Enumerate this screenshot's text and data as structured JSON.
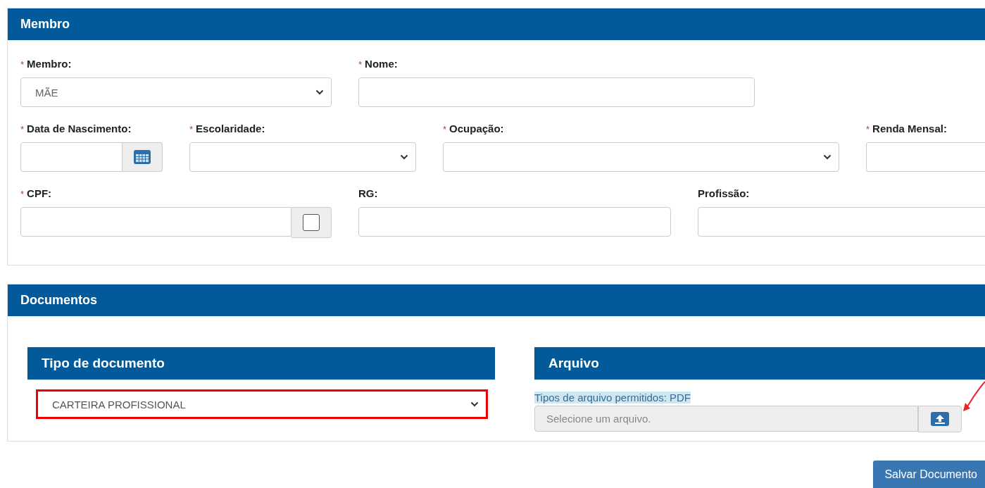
{
  "member_panel": {
    "title": "Membro",
    "rows": [
      {
        "fields": [
          {
            "required_mark": "*",
            "label": "Membro:",
            "kind": "select",
            "value": "MÃE"
          },
          {
            "required_mark": "*",
            "label": "Nome:",
            "kind": "text"
          }
        ]
      },
      {
        "fields": [
          {
            "required_mark": "*",
            "label": "Data de Nascimento:",
            "kind": "date"
          },
          {
            "required_mark": "*",
            "label": "Escolaridade:",
            "kind": "select"
          },
          {
            "required_mark": "*",
            "label": "Ocupação:",
            "kind": "select"
          },
          {
            "required_mark": "*",
            "label": "Renda Mensal:",
            "kind": "text"
          }
        ]
      },
      {
        "fields": [
          {
            "required_mark": "*",
            "label": "CPF:",
            "kind": "check-text",
            "checked": false
          },
          {
            "label": "RG:",
            "kind": "text"
          },
          {
            "label": "Profissão:",
            "kind": "text"
          }
        ]
      }
    ]
  },
  "documents_panel": {
    "title": "Documentos",
    "document_type": {
      "title": "Tipo de documento",
      "value": "CARTEIRA PROFISSIONAL",
      "highlighted": true
    },
    "file": {
      "title": "Arquivo",
      "hint": "Tipos de arquivo permitidos: PDF",
      "hint_highlighted": true,
      "placeholder": "Selecione um arquivo."
    }
  },
  "save_button": "Salvar Documento"
}
